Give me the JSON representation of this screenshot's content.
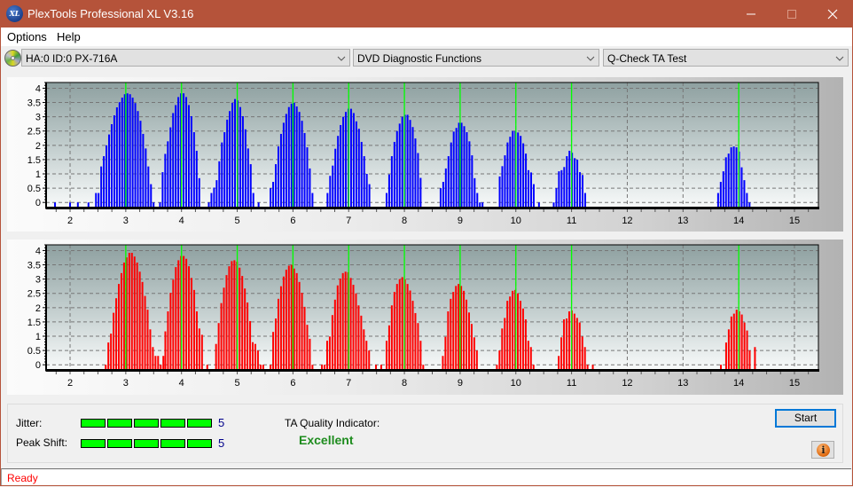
{
  "window": {
    "title": "PlexTools Professional XL V3.16",
    "app_icon_text": "XL",
    "title_bar_color": "#b5533a"
  },
  "menu": [
    {
      "label": "Options"
    },
    {
      "label": "Help"
    }
  ],
  "toolbar": {
    "drive": {
      "value": "HA:0 ID:0  PX-716A"
    },
    "function": {
      "value": "DVD Diagnostic Functions"
    },
    "test": {
      "value": "Q-Check TA Test"
    }
  },
  "results": {
    "jitter": {
      "label": "Jitter:",
      "score": "5",
      "level": 5,
      "max": 5
    },
    "peak_shift": {
      "label": "Peak Shift:",
      "score": "5",
      "level": 5,
      "max": 5
    },
    "ta_quality": {
      "label": "TA Quality Indicator:",
      "value": "Excellent"
    },
    "start_button": "Start",
    "info_glyph": "i"
  },
  "status": {
    "text": "Ready"
  },
  "colors": {
    "led_on": "#00ff00",
    "excellent": "#1e8c1e",
    "status_text": "#ff0000",
    "reference_line": "#00ff00"
  },
  "chart_data": [
    {
      "type": "bar",
      "title": "",
      "xlabel": "",
      "ylabel": "",
      "xlim": [
        1.57,
        15.43
      ],
      "ylim": [
        -0.18,
        4.2
      ],
      "grid": true,
      "bar_color": "#0000ff",
      "x_ticks": [
        "2",
        "3",
        "4",
        "5",
        "6",
        "7",
        "8",
        "9",
        "10",
        "11",
        "12",
        "13",
        "14",
        "15"
      ],
      "x_tick_values": [
        2,
        3,
        4,
        5,
        6,
        7,
        8,
        9,
        10,
        11,
        12,
        13,
        14,
        15
      ],
      "y_ticks": [
        "0",
        "0.5",
        "1",
        "1.5",
        "2",
        "2.5",
        "3",
        "3.5",
        "4"
      ],
      "y_tick_values": [
        0,
        0.5,
        1,
        1.5,
        2,
        2.5,
        3,
        3.5,
        4
      ],
      "reference_lines": [
        3,
        4,
        5,
        6,
        7,
        8,
        9,
        10,
        11,
        14
      ],
      "bin_step": 0.047,
      "peaks": [
        {
          "x_start": 1.73,
          "values": [
            0
          ]
        },
        {
          "x_start": 2.0,
          "values": [
            0
          ]
        },
        {
          "x_start": 2.14,
          "values": [
            0
          ]
        },
        {
          "x_start": 2.33,
          "values": [
            0
          ]
        },
        {
          "x_start": 2.465,
          "values": [
            0.33,
            0.33,
            1.26,
            1.62,
            2.0,
            2.38,
            2.74,
            3.05,
            3.33,
            3.51,
            3.67,
            3.79,
            3.82,
            3.79,
            3.67,
            3.48,
            3.2,
            2.86,
            2.4,
            1.89,
            1.26,
            0.64,
            0
          ]
        },
        {
          "x_start": 3.614,
          "values": [
            0,
            1.06,
            1.7,
            2.14,
            2.63,
            3.13,
            3.41,
            3.69,
            3.82,
            3.82,
            3.69,
            3.41,
            3.02,
            2.46,
            1.81,
            0.85
          ]
        },
        {
          "x_start": 4.49,
          "values": [
            0,
            0.33,
            0.52,
            0.78,
            1.44,
            2.1,
            2.46,
            2.9,
            3.2,
            3.49,
            3.62,
            3.57,
            3.34,
            3.02,
            2.56,
            1.89,
            1.34,
            0.33,
            null,
            0
          ]
        },
        {
          "x_start": 5.598,
          "values": [
            0.5,
            0.72,
            1.34,
            1.96,
            2.4,
            2.79,
            3.1,
            3.34,
            3.46,
            3.49,
            3.36,
            3.17,
            2.86,
            2.43,
            1.93,
            1.19,
            0.33
          ]
        },
        {
          "x_start": 6.62,
          "values": [
            0.33,
            0.93,
            1.29,
            1.88,
            2.33,
            2.71,
            3.0,
            3.17,
            3.28,
            3.28,
            3.13,
            2.84,
            2.58,
            2.12,
            1.62,
            1.0,
            0.64
          ]
        },
        {
          "x_start": 7.68,
          "values": [
            0.33,
            0.98,
            1.62,
            2.12,
            2.5,
            2.76,
            3.0,
            3.07,
            3.07,
            2.89,
            2.64,
            2.24,
            1.73,
            0.86
          ]
        },
        {
          "x_start": 8.65,
          "values": [
            0.5,
            0.72,
            1.19,
            1.62,
            2.1,
            2.48,
            2.61,
            2.79,
            2.79,
            2.67,
            2.46,
            2.14,
            1.65,
            0.85,
            0.33,
            0,
            0
          ]
        },
        {
          "x_start": 9.71,
          "values": [
            0.91,
            1.27,
            1.65,
            2.1,
            2.3,
            2.5,
            2.5,
            2.45,
            2.33,
            2.07,
            1.71,
            1.13,
            1.05,
            0.64,
            null,
            0
          ]
        },
        {
          "x_start": 10.68,
          "values": [
            0,
            0.5,
            1.09,
            1.13,
            1.24,
            1.62,
            1.81,
            1.74,
            1.55,
            1.5,
            1.06,
            0.96,
            0.33
          ]
        },
        {
          "x_start": 13.63,
          "values": [
            0.33,
            0.72,
            1.09,
            1.58,
            1.71,
            1.93,
            1.96,
            1.93,
            1.78,
            1.23,
            0.78,
            0.33,
            0
          ]
        }
      ]
    },
    {
      "type": "bar",
      "title": "",
      "xlabel": "",
      "ylabel": "",
      "xlim": [
        1.57,
        15.43
      ],
      "ylim": [
        -0.18,
        4.2
      ],
      "grid": true,
      "bar_color": "#ff0000",
      "x_ticks": [
        "2",
        "3",
        "4",
        "5",
        "6",
        "7",
        "8",
        "9",
        "10",
        "11",
        "12",
        "13",
        "14",
        "15"
      ],
      "x_tick_values": [
        2,
        3,
        4,
        5,
        6,
        7,
        8,
        9,
        10,
        11,
        12,
        13,
        14,
        15
      ],
      "y_ticks": [
        "0",
        "0.5",
        "1",
        "1.5",
        "2",
        "2.5",
        "3",
        "3.5",
        "4"
      ],
      "y_tick_values": [
        0,
        0.5,
        1,
        1.5,
        2,
        2.5,
        3,
        3.5,
        4
      ],
      "reference_lines": [
        3,
        4,
        5,
        6,
        7,
        8,
        9,
        10,
        11,
        14
      ],
      "bin_step": 0.047,
      "peaks": [
        {
          "x_start": 2.64,
          "values": [
            0,
            0.78,
            1.09,
            1.82,
            2.33,
            2.83,
            3.21,
            3.58,
            3.76,
            3.92,
            3.92,
            3.79,
            3.58,
            3.26,
            2.9,
            2.41,
            1.93,
            1.24,
            0.62,
            0.31,
            0.31,
            0,
            0.31
          ]
        },
        {
          "x_start": 3.71,
          "values": [
            1.17,
            1.87,
            2.52,
            2.98,
            3.42,
            3.66,
            3.81,
            3.81,
            3.71,
            3.45,
            3.04,
            2.62,
            1.87,
            1.27,
            1.05,
            null,
            0
          ]
        },
        {
          "x_start": 4.62,
          "values": [
            0.73,
            1.46,
            2.16,
            2.7,
            3.14,
            3.45,
            3.63,
            3.66,
            3.61,
            3.4,
            3.11,
            2.67,
            2.18,
            1.53,
            0.79,
            0.73,
            0.5,
            0,
            0
          ]
        },
        {
          "x_start": 5.598,
          "values": [
            0,
            1.15,
            1.62,
            2.31,
            2.75,
            3.09,
            3.33,
            3.47,
            3.5,
            3.37,
            3.21,
            2.9,
            2.52,
            2.03,
            1.4,
            0.91,
            0
          ]
        },
        {
          "x_start": 6.52,
          "values": [
            0,
            0,
            0.84,
            0.99,
            1.74,
            2.28,
            2.78,
            3.02,
            3.21,
            3.26,
            3.24,
            3.04,
            2.8,
            2.5,
            2.08,
            1.72,
            1.24,
            0.84,
            0.5
          ]
        },
        {
          "x_start": 7.49,
          "values": [
            0,
            null,
            0
          ]
        },
        {
          "x_start": 7.68,
          "values": [
            0.84,
            1.38,
            2.08,
            2.55,
            2.83,
            3.0,
            3.07,
            3.0,
            2.83,
            2.6,
            2.24,
            1.81,
            1.46,
            0.84,
            0
          ]
        },
        {
          "x_start": 8.69,
          "values": [
            0.31,
            0.98,
            1.87,
            2.31,
            2.55,
            2.76,
            2.83,
            2.76,
            2.59,
            2.28,
            1.83,
            1.43,
            0.96,
            0.5
          ]
        },
        {
          "x_start": 9.66,
          "values": [
            0,
            0.5,
            1.27,
            1.64,
            2.24,
            2.39,
            2.59,
            2.62,
            2.5,
            2.24,
            1.97,
            1.59,
            0.84,
            0.62,
            0
          ]
        },
        {
          "x_start": 10.77,
          "values": [
            0.31,
            0.96,
            1.59,
            1.62,
            1.87,
            1.9,
            1.79,
            1.64,
            1.48,
            0.99,
            0.62,
            0,
            null,
            0
          ]
        },
        {
          "x_start": 13.68,
          "values": [
            0,
            null,
            0.78,
            1.24,
            1.69,
            1.79,
            1.93,
            1.87,
            1.76,
            1.48,
            1.2,
            0.5,
            null,
            0.62
          ]
        }
      ]
    }
  ]
}
